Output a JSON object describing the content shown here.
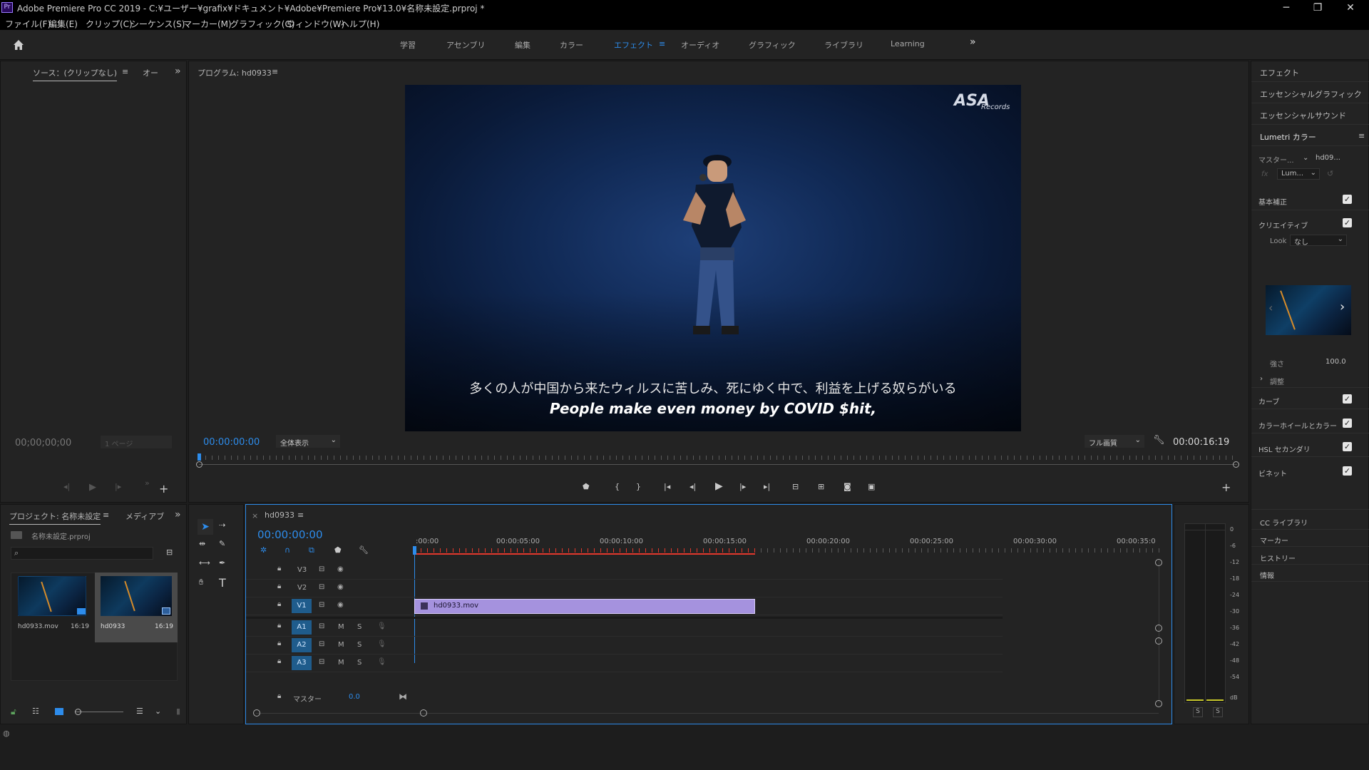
{
  "titlebar": {
    "app_icon": "Pr",
    "title": "Adobe Premiere Pro CC 2019 - C:¥ユーザー¥grafix¥ドキュメント¥Adobe¥Premiere Pro¥13.0¥名称未設定.prproj *",
    "minimize": "─",
    "restore": "❐",
    "close": "✕"
  },
  "menu": [
    "ファイル(F)",
    "編集(E)",
    "クリップ(C)",
    "シーケンス(S)",
    "マーカー(M)",
    "グラフィック(G)",
    "ウィンドウ(W)",
    "ヘルプ(H)"
  ],
  "workspaces": {
    "items": [
      "学習",
      "アセンブリ",
      "編集",
      "カラー",
      "エフェクト",
      "オーディオ",
      "グラフィック",
      "ライブラリ",
      "Learning"
    ],
    "active": "エフェクト",
    "more": "»"
  },
  "source": {
    "tab": "ソース：(クリップなし)",
    "tab2": "オー",
    "timecode": "00;00;00;00",
    "page": "1 ページ"
  },
  "program": {
    "tab": "プログラム: hd0933",
    "timecode_left": "00:00:00:00",
    "fit": "全体表示",
    "quality": "フル画質",
    "timecode_right": "00:00:16:19",
    "watermark": "ASA",
    "watermark_sub": "Records",
    "subtitle_jp": "多くの人が中国から来たウィルスに苦しみ、死にゆく中で、利益を上げる奴らがいる",
    "subtitle_en": "People make even money by COVID $hit,"
  },
  "project": {
    "tab": "プロジェクト: 名称未設定",
    "tab2": "メディアブ",
    "file": "名称未設定.prproj",
    "items": [
      {
        "name": "hd0933.mov",
        "duration": "16:19"
      },
      {
        "name": "hd0933",
        "duration": "16:19"
      }
    ]
  },
  "timeline": {
    "tab": "hd0933",
    "timecode": "00:00:00:00",
    "ruler": [
      ":00:00",
      "00:00:05:00",
      "00:00:10:00",
      "00:00:15:00",
      "00:00:20:00",
      "00:00:25:00",
      "00:00:30:00",
      "00:00:35:0"
    ],
    "video_tracks": [
      "V3",
      "V2",
      "V1"
    ],
    "audio_tracks": [
      "A1",
      "A2",
      "A3"
    ],
    "master_label": "マスター",
    "master_value": "0.0",
    "clip_name": "hd0933.mov",
    "mute": "M",
    "solo": "S"
  },
  "meter": {
    "scale": [
      "0",
      "-6",
      "-12",
      "-18",
      "-24",
      "-30",
      "-36",
      "-42",
      "-48",
      "-54",
      "dB"
    ],
    "s1": "S",
    "s2": "S"
  },
  "right_panel": {
    "effects": "エフェクト",
    "essential_graphics": "エッセンシャルグラフィック",
    "essential_sound": "エッセンシャルサウンド",
    "lumetri": "Lumetri カラー",
    "master": "マスター...",
    "clip": "hd09...",
    "fx_dropdown": "Lum...",
    "basic": "基本補正",
    "creative": "クリエイティブ",
    "look_label": "Look",
    "look_value": "なし",
    "strength_label": "強さ",
    "strength_value": "100.0",
    "adjust": "調整",
    "curves": "カーブ",
    "color_wheels": "カラーホイールとカラー",
    "hsl": "HSL セカンダリ",
    "vignette": "ビネット",
    "cc_library": "CC ライブラリ",
    "markers": "マーカー",
    "history": "ヒストリー",
    "info": "情報"
  }
}
